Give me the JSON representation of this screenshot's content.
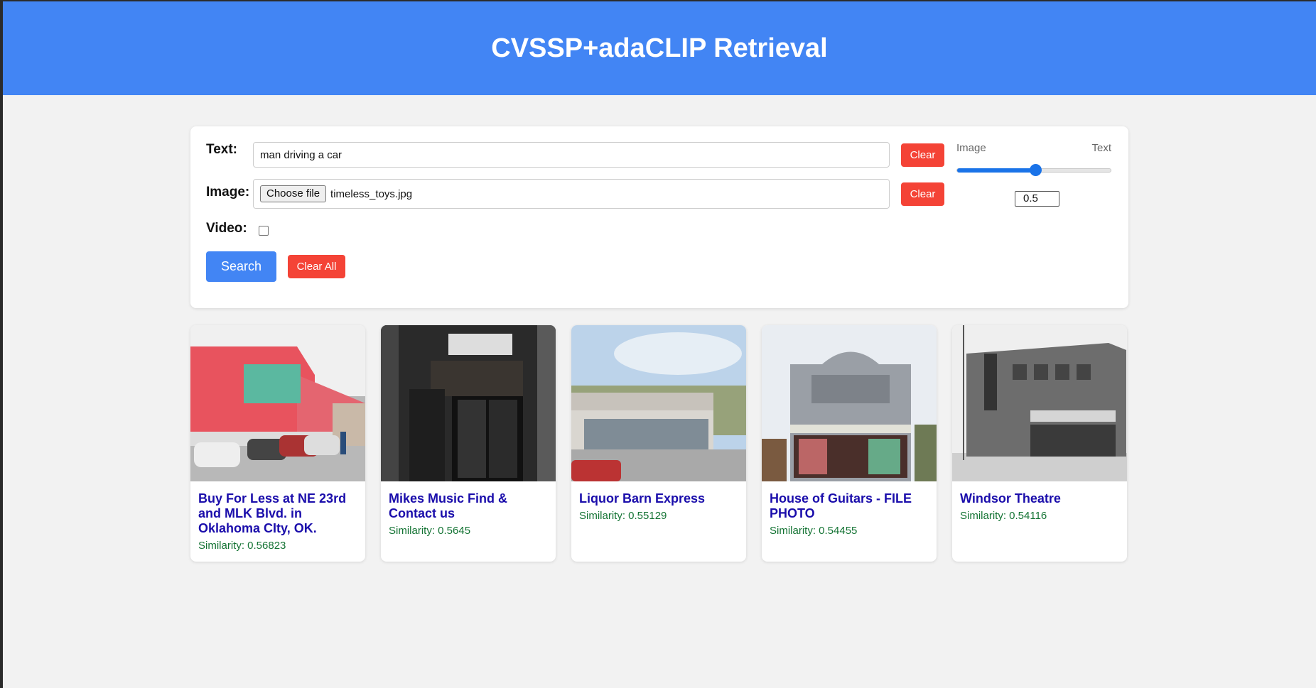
{
  "header": {
    "title": "CVSSP+adaCLIP Retrieval"
  },
  "form": {
    "text_label": "Text:",
    "text_value": "man driving a car",
    "image_label": "Image:",
    "file_button": "Choose file",
    "file_name": "timeless_toys.jpg",
    "video_label": "Video:",
    "video_checked": false,
    "clear_text": "Clear",
    "clear_image": "Clear",
    "search": "Search",
    "clear_all": "Clear All"
  },
  "weight": {
    "left_label": "Image",
    "right_label": "Text",
    "value": "0.5",
    "fraction": 0.5
  },
  "colors": {
    "header": "#4285f4",
    "primary": "#4285f4",
    "danger": "#f44336",
    "link": "#1a0dab",
    "similarity": "#137333"
  },
  "results": [
    {
      "title": "Buy For Less at NE 23rd and MLK Blvd. in Oklahoma CIty, OK.",
      "similarity": "Similarity: 0.56823"
    },
    {
      "title": "Mikes Music Find & Contact us",
      "similarity": "Similarity: 0.5645"
    },
    {
      "title": "Liquor Barn Express",
      "similarity": "Similarity: 0.55129"
    },
    {
      "title": "House of Guitars - FILE PHOTO",
      "similarity": "Similarity: 0.54455"
    },
    {
      "title": "Windsor Theatre",
      "similarity": "Similarity: 0.54116"
    }
  ]
}
